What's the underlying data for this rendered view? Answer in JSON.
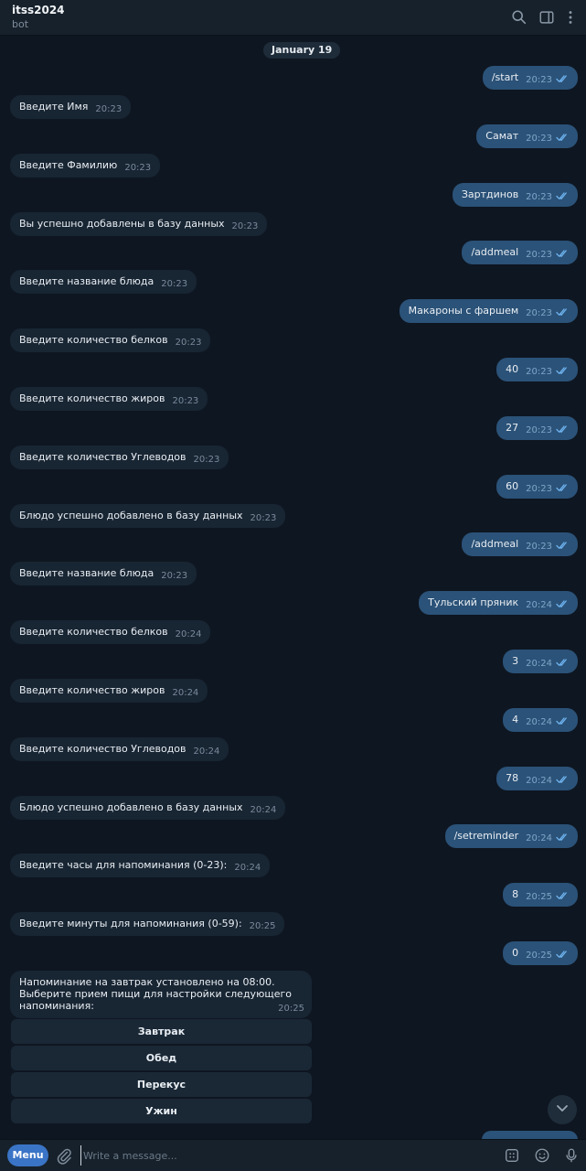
{
  "header": {
    "title": "itss2024",
    "subtitle": "bot"
  },
  "chat": {
    "date_label": "January 19",
    "messages": [
      {
        "dir": "out",
        "text": "/start",
        "time": "20:23"
      },
      {
        "dir": "in",
        "text": "Введите Имя",
        "time": "20:23"
      },
      {
        "dir": "out",
        "text": "Самат",
        "time": "20:23"
      },
      {
        "dir": "in",
        "text": "Введите Фамилию",
        "time": "20:23"
      },
      {
        "dir": "out",
        "text": "Зартдинов",
        "time": "20:23"
      },
      {
        "dir": "in",
        "text": "Вы успешно добавлены в базу данных",
        "time": "20:23"
      },
      {
        "dir": "out",
        "text": "/addmeal",
        "time": "20:23"
      },
      {
        "dir": "in",
        "text": "Введите название блюда",
        "time": "20:23"
      },
      {
        "dir": "out",
        "text": "Макароны с фаршем",
        "time": "20:23"
      },
      {
        "dir": "in",
        "text": "Введите количество белков",
        "time": "20:23"
      },
      {
        "dir": "out",
        "text": "40",
        "time": "20:23"
      },
      {
        "dir": "in",
        "text": "Введите количество жиров",
        "time": "20:23"
      },
      {
        "dir": "out",
        "text": "27",
        "time": "20:23"
      },
      {
        "dir": "in",
        "text": "Введите количество Углеводов",
        "time": "20:23"
      },
      {
        "dir": "out",
        "text": "60",
        "time": "20:23"
      },
      {
        "dir": "in",
        "text": "Блюдо успешно добавлено в базу данных",
        "time": "20:23"
      },
      {
        "dir": "out",
        "text": "/addmeal",
        "time": "20:23"
      },
      {
        "dir": "in",
        "text": "Введите название блюда",
        "time": "20:23"
      },
      {
        "dir": "out",
        "text": "Тульский пряник",
        "time": "20:24"
      },
      {
        "dir": "in",
        "text": "Введите количество белков",
        "time": "20:24"
      },
      {
        "dir": "out",
        "text": "3",
        "time": "20:24"
      },
      {
        "dir": "in",
        "text": "Введите количество жиров",
        "time": "20:24"
      },
      {
        "dir": "out",
        "text": "4",
        "time": "20:24"
      },
      {
        "dir": "in",
        "text": "Введите количество Углеводов",
        "time": "20:24"
      },
      {
        "dir": "out",
        "text": "78",
        "time": "20:24"
      },
      {
        "dir": "in",
        "text": "Блюдо успешно добавлено в базу данных",
        "time": "20:24"
      },
      {
        "dir": "out",
        "text": "/setreminder",
        "time": "20:24"
      },
      {
        "dir": "in",
        "text": "Введите часы для напоминания (0-23):",
        "time": "20:24"
      },
      {
        "dir": "out",
        "text": "8",
        "time": "20:25"
      },
      {
        "dir": "in",
        "text": "Введите минуты для напоминания (0-59):",
        "time": "20:25"
      },
      {
        "dir": "out",
        "text": "0",
        "time": "20:25"
      }
    ],
    "last_message": {
      "lines": [
        "Напоминание на завтрак установлено на 08:00.",
        "Выберите прием пищи для настройки следующего",
        "напоминания:"
      ],
      "time": "20:25"
    },
    "keyboard": [
      "Завтрак",
      "Обед",
      "Перекус",
      "Ужин"
    ]
  },
  "input": {
    "menu_label": "Menu",
    "placeholder": "Write a message..."
  },
  "colors": {
    "background": "#0e1621",
    "incoming_bubble": "#182533",
    "outgoing_bubble": "#2b5278",
    "menu_button": "#3a74c6"
  }
}
